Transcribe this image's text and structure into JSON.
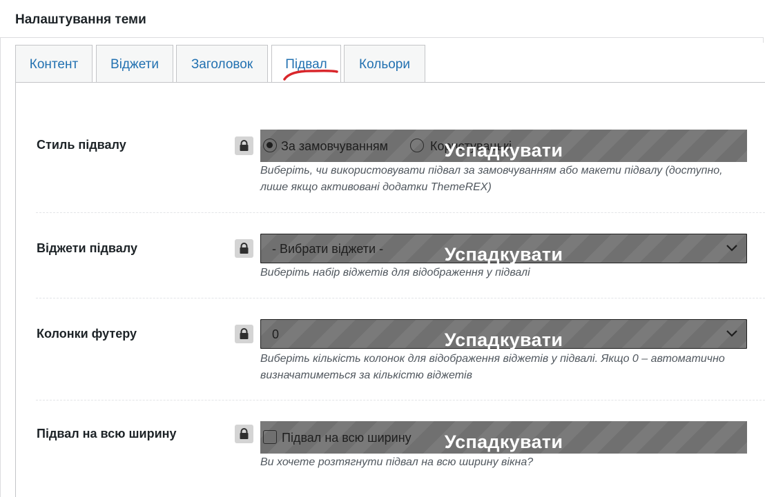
{
  "panel": {
    "title": "Налаштування теми"
  },
  "tabs": [
    {
      "label": "Контент"
    },
    {
      "label": "Віджети"
    },
    {
      "label": "Заголовок"
    },
    {
      "label": "Підвал"
    },
    {
      "label": "Кольори"
    }
  ],
  "active_tab": "Підвал",
  "inherit_label": "Успадкувати",
  "rows": [
    {
      "label": "Стиль підвалу",
      "options": [
        {
          "label": "За замовчуванням",
          "selected": true
        },
        {
          "label": "Користувацькі",
          "selected": false
        }
      ],
      "description": "Виберіть, чи використовувати підвал за замовчуванням або макети підвалу (доступно, лише якщо активовані додатки ThemeREX)"
    },
    {
      "label": "Віджети підвалу",
      "select_value": "- Вибрати віджети -",
      "description": "Виберіть набір віджетів для відображення у підвалі"
    },
    {
      "label": "Колонки футеру",
      "select_value": "0",
      "description": "Виберіть кількість колонок для відображення віджетів у підвалі. Якщо 0 – автоматично визначатиметься за кількістю віджетів"
    },
    {
      "label": "Підвал на всю ширину",
      "checkbox_label": "Підвал на всю ширину",
      "checked": false,
      "description": "Ви хочете розтягнути підвал на всю ширину вікна?"
    }
  ],
  "colors": {
    "tab_text": "#2271b1",
    "inherit_overlay": "#707070",
    "annotation_underline": "#d9262b"
  },
  "icons": {
    "lock": "lock-icon",
    "chevron": "chevron-down-icon"
  }
}
